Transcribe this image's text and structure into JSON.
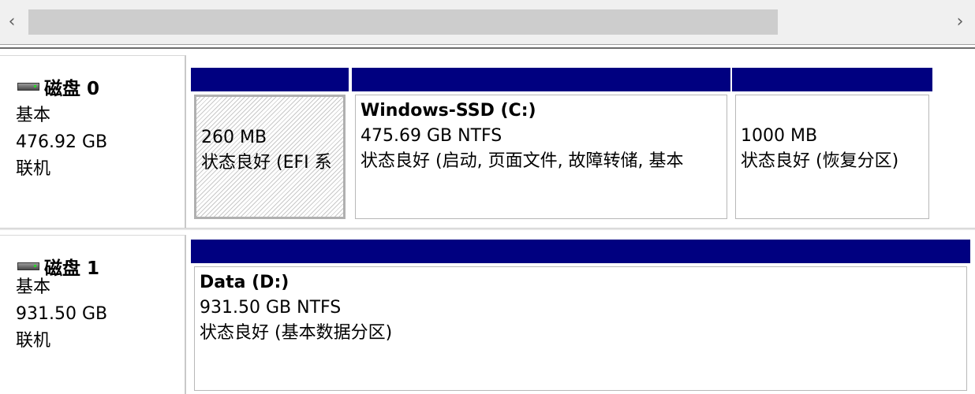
{
  "scrollbar": {
    "left_arrow": "‹",
    "right_arrow": "›"
  },
  "disks": [
    {
      "title": "磁盘 0",
      "type": "基本",
      "size": "476.92 GB",
      "status": "联机",
      "partitions": [
        {
          "name": "",
          "size": "260 MB",
          "status": "状态良好 (EFI 系"
        },
        {
          "name": "Windows-SSD  (C:)",
          "size": "475.69 GB NTFS",
          "status": "状态良好 (启动, 页面文件, 故障转储, 基本"
        },
        {
          "name": "",
          "size": "1000 MB",
          "status": "状态良好 (恢复分区)"
        }
      ]
    },
    {
      "title": "磁盘 1",
      "type": "基本",
      "size": "931.50 GB",
      "status": "联机",
      "partitions": [
        {
          "name": "Data  (D:)",
          "size": "931.50 GB NTFS",
          "status": "状态良好 (基本数据分区)"
        }
      ]
    }
  ],
  "colors": {
    "partition_bar": "#000080",
    "scroll_thumb": "#cdcdcd",
    "panel_bg": "#f0f0f0"
  }
}
